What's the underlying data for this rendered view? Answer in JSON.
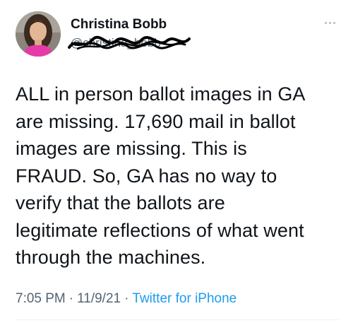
{
  "tweet": {
    "display_name": "Christina Bobb",
    "handle": "@christina_bobb",
    "more_icon": "ellipsis-icon",
    "text": "ALL in person ballot images in GA\nare missing.  17,690 mail in ballot\nimages are missing.  This is\nFRAUD.  So, GA has no way to\nverify that the ballots are\nlegitimate reflections of what went\nthrough the machines.",
    "time": "7:05 PM",
    "date": "11/9/21",
    "separator": "·",
    "source": "Twitter for iPhone"
  },
  "colors": {
    "text_primary": "#0f1419",
    "text_secondary": "#536471",
    "link": "#1d9bf0",
    "scribble": "#000000"
  }
}
